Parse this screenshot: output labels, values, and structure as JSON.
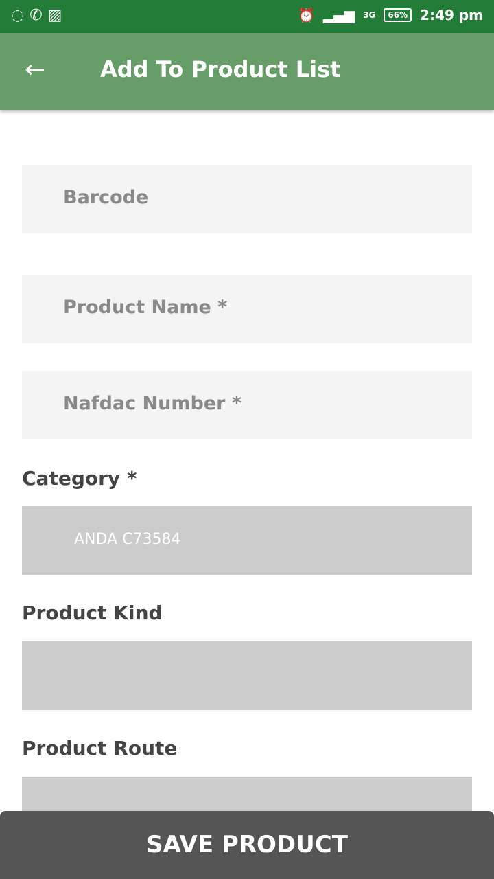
{
  "status_bar": {
    "time": "2:49 pm",
    "battery": "66%",
    "network": "3G",
    "left_icons": [
      "sync-icon",
      "whatsapp-icon",
      "image-icon"
    ],
    "right_icons": [
      "alarm-icon",
      "signal-icon",
      "signal-3g-icon",
      "battery-icon"
    ]
  },
  "app_bar": {
    "title": "Add To Product List",
    "back_icon": "arrow-left-icon"
  },
  "form": {
    "barcode": {
      "placeholder": "Barcode",
      "value": ""
    },
    "product_name": {
      "placeholder": "Product Name *",
      "value": ""
    },
    "nafdac_number": {
      "placeholder": "Nafdac Number *",
      "value": ""
    },
    "category": {
      "label": "Category *",
      "selected": "ANDA C73584"
    },
    "product_kind": {
      "label": "Product Kind",
      "selected": ""
    },
    "product_route": {
      "label": "Product Route",
      "selected": ""
    }
  },
  "save_button": {
    "label": "SAVE PRODUCT"
  },
  "colors": {
    "status_bar": "#247c39",
    "app_bar": "#679d68",
    "button": "#555555",
    "select": "#cccccc",
    "field": "#f4f4f4"
  }
}
